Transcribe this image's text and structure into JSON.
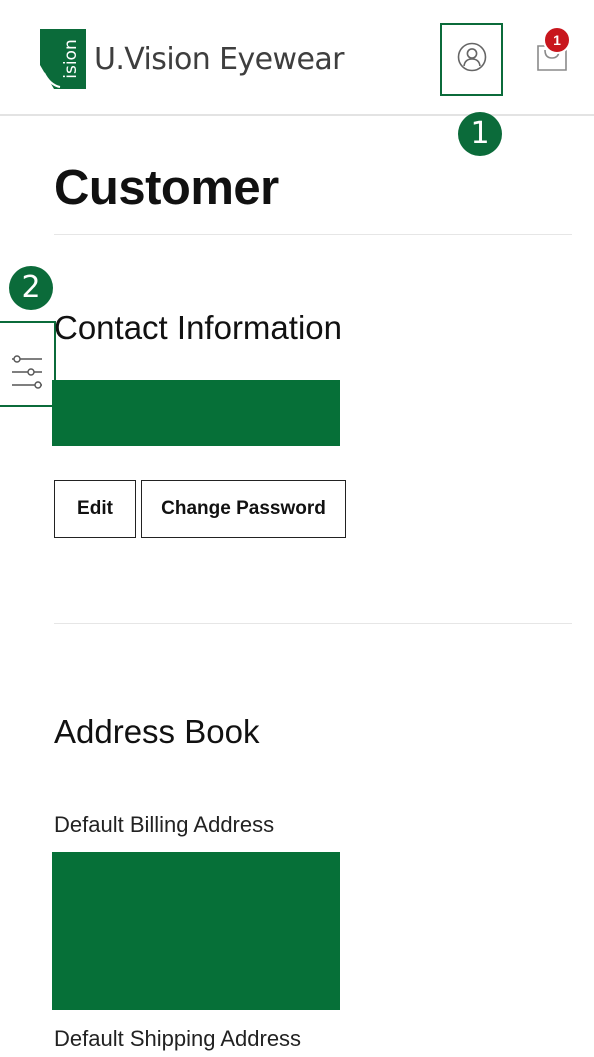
{
  "header": {
    "logo_text": "U.Vision Eyewear",
    "logo_mark_text": "ision",
    "cart_count": "1",
    "account_icon": "user-account-icon",
    "cart_icon": "shopping-bag-icon"
  },
  "annotations": {
    "marker_1": "1",
    "marker_2": "2"
  },
  "page": {
    "title": "Customer"
  },
  "contact": {
    "heading": "Contact Information",
    "edit_label": "Edit",
    "change_password_label": "Change Password"
  },
  "address_book": {
    "heading": "Address Book",
    "default_billing_label": "Default Billing Address",
    "default_shipping_label": "Default Shipping Address"
  },
  "sidebar": {
    "filter_icon": "sliders-icon"
  },
  "colors": {
    "brand_green": "#0b6b3a",
    "redaction_green": "#067038",
    "badge_red": "#c8161d"
  }
}
